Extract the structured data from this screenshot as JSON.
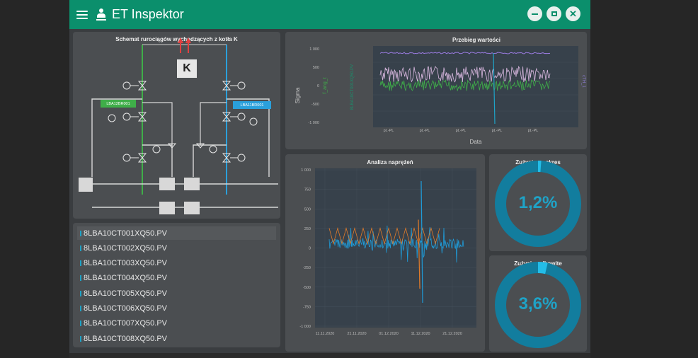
{
  "app": {
    "title": "ET Inspektor"
  },
  "schematic": {
    "title": "Schemat rurociągów wychodzących z kotła K",
    "boiler_label": "K",
    "tag_left": "LBA12BR001",
    "tag_right": "LBA11BR001"
  },
  "list": {
    "items": [
      "8LBA10CT001XQ50.PV",
      "8LBA10CT002XQ50.PV",
      "8LBA10CT003XQ50.PV",
      "8LBA10CT004XQ50.PV",
      "8LBA10CT005XQ50.PV",
      "8LBA10CT006XQ50.PV",
      "8LBA10CT007XQ50.PV",
      "8LBA10CT008XQ50.PV"
    ]
  },
  "trend": {
    "title": "Przebieg wartości",
    "xlabel": "Data",
    "ylabel": "Sigma",
    "ylabel2": "f_ang_t",
    "ylabel3": "8LBA10CT001XQ50.PV",
    "ylabel4": "cTH_1",
    "yticks": [
      "1 000",
      "500",
      "0",
      "-500",
      "-1 000"
    ],
    "xticks": [
      "pt.-PL",
      "pt.-PL",
      "pt.-PL",
      "pt.-PL",
      "pt.-PL"
    ]
  },
  "stress": {
    "title": "Analiza naprężeń",
    "yticks": [
      "1 000",
      "750",
      "500",
      "250",
      "0",
      "-250",
      "-500",
      "-750",
      "-1 000"
    ],
    "xticks": [
      "11.11.2020",
      "21.11.2020",
      "01.12.2020",
      "11.12.2020",
      "21.12.2020"
    ]
  },
  "usage_period": {
    "title": "Zużycie za okres",
    "value": "1,2%",
    "fraction": 0.012
  },
  "usage_total": {
    "title": "Zużycie całkowite",
    "value": "3,6%",
    "fraction": 0.036
  },
  "colors": {
    "accent": "#0b8f6c",
    "cyan": "#1fa3c7",
    "green": "#3fae49",
    "blue_tag": "#2aa0dc",
    "orange": "#e07b2a",
    "pink": "#d9b8e0"
  }
}
